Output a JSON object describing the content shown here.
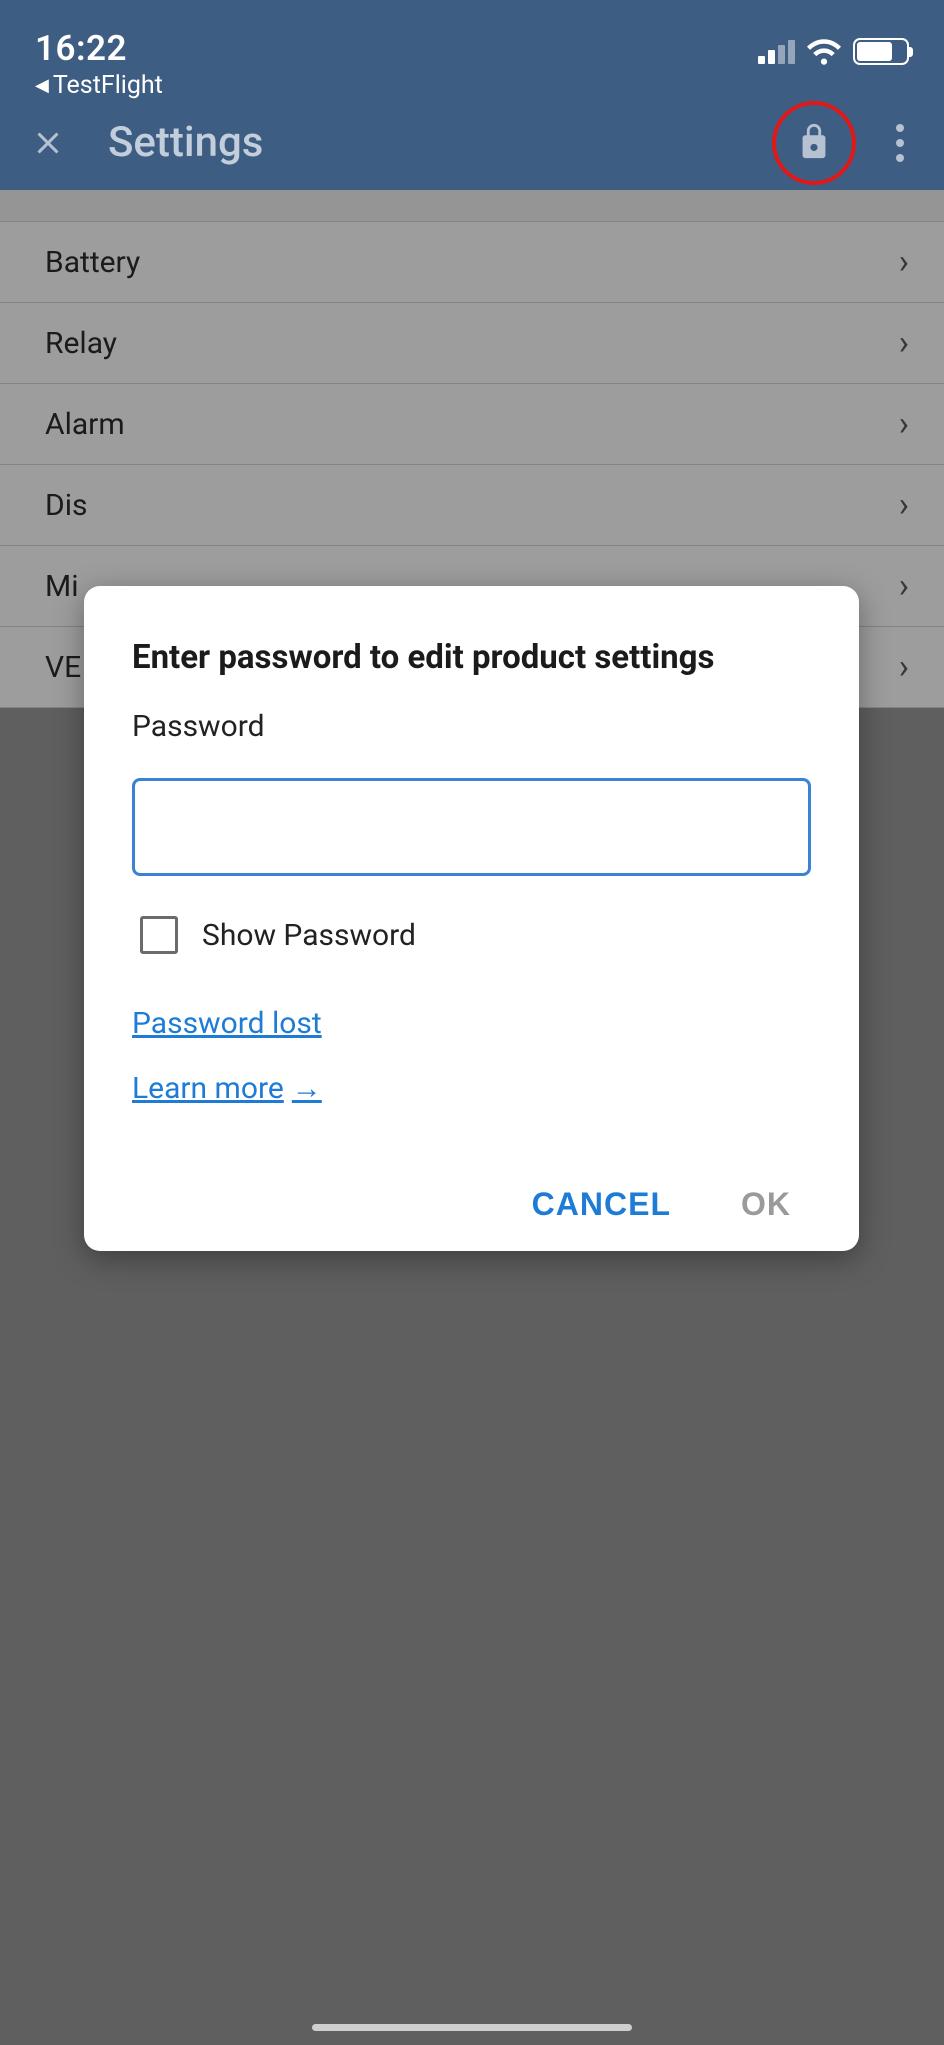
{
  "status_bar": {
    "time": "16:22",
    "back_app": "TestFlight"
  },
  "app_bar": {
    "title": "Settings"
  },
  "settings": {
    "items": [
      {
        "label": "Battery"
      },
      {
        "label": "Relay"
      },
      {
        "label": "Alarm"
      },
      {
        "label": "Dis"
      },
      {
        "label": "Mi"
      },
      {
        "label": "VE"
      }
    ]
  },
  "dialog": {
    "title": "Enter password to edit product settings",
    "password_label": "Password",
    "password_value": "",
    "show_password_label": "Show Password",
    "password_lost_link": "Password lost",
    "learn_more_link": "Learn more",
    "cancel_label": "CANCEL",
    "ok_label": "OK"
  }
}
